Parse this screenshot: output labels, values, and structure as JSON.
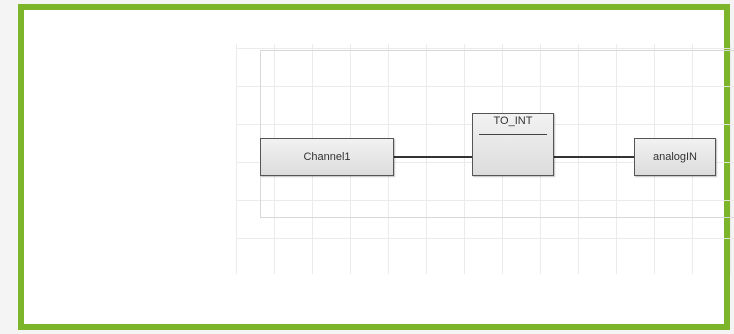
{
  "diagram": {
    "input_variable": "Channel1",
    "function_block": "TO_INT",
    "output_variable": "analogIN"
  },
  "colors": {
    "frame_border": "#7cb52a",
    "wire": "#333333"
  }
}
